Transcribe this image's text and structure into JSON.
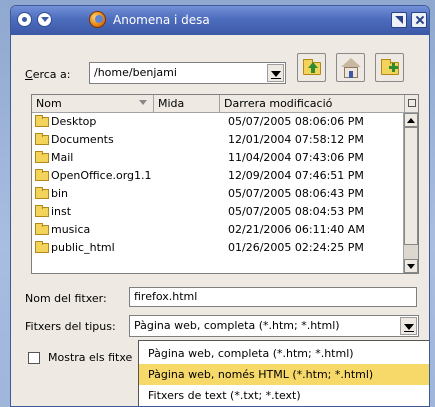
{
  "window": {
    "title": "Anomena i desa"
  },
  "location": {
    "label": "Cerca a:",
    "value": "/home/benjami"
  },
  "toolbar": {
    "up_folder": "up-folder",
    "home": "home",
    "new_folder": "new-folder"
  },
  "columns": {
    "name": "Nom",
    "size": "Mida",
    "modified": "Darrera modificació"
  },
  "files": [
    {
      "name": "Desktop",
      "modified": "05/07/2005 08:06:06 PM"
    },
    {
      "name": "Documents",
      "modified": "12/01/2004 07:58:12 PM"
    },
    {
      "name": "Mail",
      "modified": "11/04/2004 07:43:06 PM"
    },
    {
      "name": "OpenOffice.org1.1",
      "modified": "12/09/2004 07:46:51 PM"
    },
    {
      "name": "bin",
      "modified": "05/07/2005 08:06:43 PM"
    },
    {
      "name": "inst",
      "modified": "05/07/2005 08:04:53 PM"
    },
    {
      "name": "musica",
      "modified": "02/21/2006 06:11:40 AM"
    },
    {
      "name": "public_html",
      "modified": "01/26/2005 02:24:25 PM"
    }
  ],
  "filename": {
    "label": "Nom del fitxer:",
    "value": "firefox.html"
  },
  "filetype": {
    "label": "Fitxers del tipus:",
    "value": "Pàgina web, completa (*.htm; *.html)",
    "options": [
      "Pàgina web, completa (*.htm; *.html)",
      "Pàgina web, només HTML (*.htm; *.html)",
      "Fitxers de text (*.txt; *.text)"
    ]
  },
  "show_hidden": {
    "label": "Mostra els fitxe"
  },
  "colors": {
    "titlebar": "#4d6dbd",
    "highlight": "#f7d96a",
    "window_bg": "#eeeae3"
  }
}
